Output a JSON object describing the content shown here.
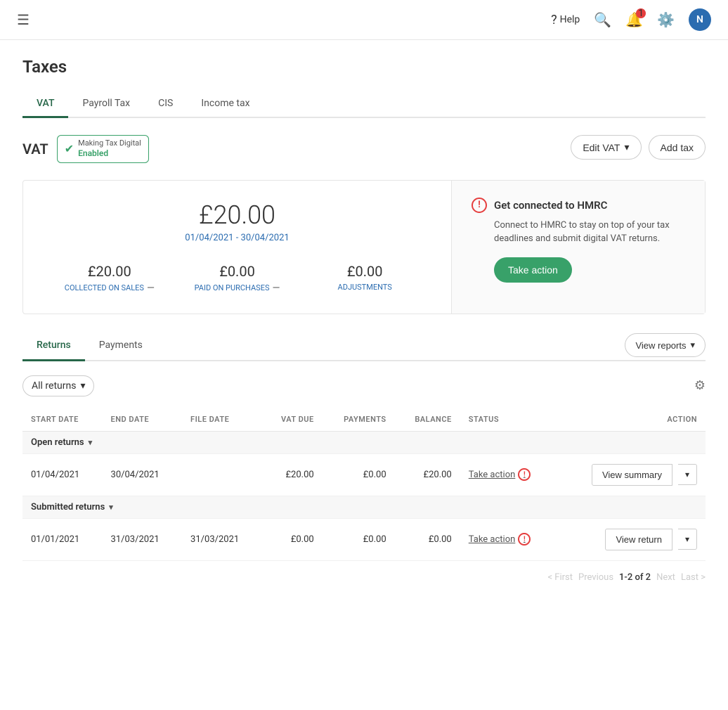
{
  "app": {
    "title": "Taxes",
    "help_label": "Help",
    "avatar_letter": "N"
  },
  "main_tabs": [
    {
      "id": "vat",
      "label": "VAT",
      "active": true
    },
    {
      "id": "payroll",
      "label": "Payroll Tax",
      "active": false
    },
    {
      "id": "cis",
      "label": "CIS",
      "active": false
    },
    {
      "id": "income",
      "label": "Income tax",
      "active": false
    }
  ],
  "vat": {
    "label": "VAT",
    "mtd": {
      "line1": "Making Tax Digital",
      "line2": "Enabled"
    },
    "edit_button": "Edit VAT",
    "add_button": "Add tax",
    "summary": {
      "total_amount": "£20.00",
      "date_range": "01/04/2021 - 30/04/2021",
      "collected_amount": "£20.00",
      "collected_label": "COLLECTED ON SALES",
      "paid_amount": "£0.00",
      "paid_label": "PAID ON PURCHASES",
      "adjustments_amount": "£0.00",
      "adjustments_label": "ADJUSTMENTS"
    },
    "hmrc_card": {
      "title": "Get connected to HMRC",
      "description": "Connect to HMRC to stay on top of your tax deadlines and submit digital VAT returns.",
      "action_label": "Take action"
    }
  },
  "sub_tabs": [
    {
      "id": "returns",
      "label": "Returns",
      "active": true
    },
    {
      "id": "payments",
      "label": "Payments",
      "active": false
    }
  ],
  "view_reports_button": "View reports",
  "filter": {
    "label": "All returns",
    "placeholder": "All returns"
  },
  "table": {
    "columns": [
      {
        "id": "start_date",
        "label": "START DATE"
      },
      {
        "id": "end_date",
        "label": "END DATE"
      },
      {
        "id": "file_date",
        "label": "FILE DATE"
      },
      {
        "id": "vat_due",
        "label": "VAT DUE"
      },
      {
        "id": "payments",
        "label": "PAYMENTS"
      },
      {
        "id": "balance",
        "label": "BALANCE"
      },
      {
        "id": "status",
        "label": "STATUS"
      },
      {
        "id": "action",
        "label": "ACTION"
      }
    ],
    "groups": [
      {
        "label": "Open returns",
        "rows": [
          {
            "start_date": "01/04/2021",
            "end_date": "30/04/2021",
            "file_date": "",
            "vat_due": "£20.00",
            "payments": "£0.00",
            "balance": "£20.00",
            "status_label": "Take action",
            "view_label": "View summary",
            "chevron": "▾"
          }
        ]
      },
      {
        "label": "Submitted returns",
        "rows": [
          {
            "start_date": "01/01/2021",
            "end_date": "31/03/2021",
            "file_date": "31/03/2021",
            "vat_due": "£0.00",
            "payments": "£0.00",
            "balance": "£0.00",
            "status_label": "Take action",
            "view_label": "View return",
            "chevron": "▾"
          }
        ]
      }
    ]
  },
  "pagination": {
    "first": "< First",
    "previous": "Previous",
    "current": "1-2 of 2",
    "next": "Next",
    "last": "Last >"
  }
}
